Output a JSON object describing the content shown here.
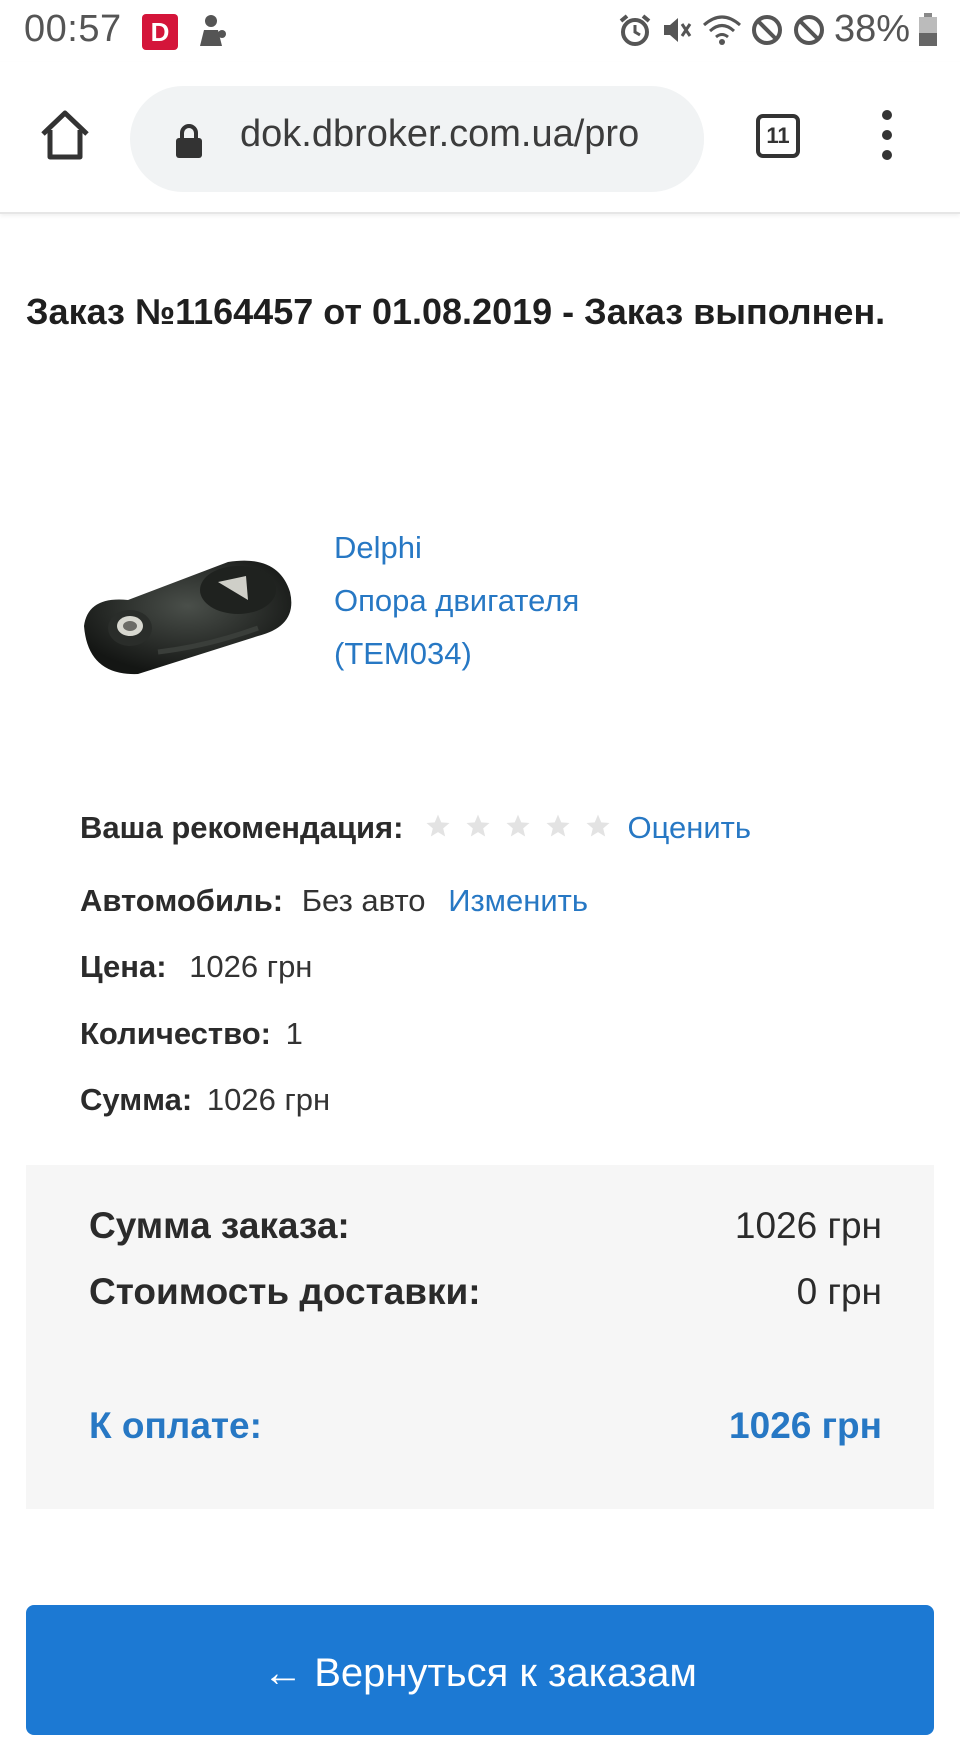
{
  "status_bar": {
    "time": "00:57",
    "app_badge_letter": "D",
    "battery_percent": "38%",
    "icons": [
      "alarm-icon",
      "vibrate-icon",
      "wifi-icon",
      "block-icon",
      "block-icon",
      "battery-icon"
    ]
  },
  "browser": {
    "url": "dok.dbroker.com.ua/pro",
    "tab_count": "11"
  },
  "order": {
    "title": "Заказ №1164457 от 01.08.2019 - Заказ выполнен."
  },
  "product": {
    "brand": "Delphi",
    "name": "Опора двигателя",
    "code": "(TEM034)"
  },
  "details": {
    "recommendation_label": "Ваша рекомендация:",
    "rating": 0,
    "rating_max": 5,
    "rate_link": "Оценить",
    "car_label": "Автомобиль:",
    "car_value": "Без авто",
    "change_link": "Изменить",
    "price_label": "Цена:",
    "price_value": "1026 грн",
    "qty_label": "Количество:",
    "qty_value": "1",
    "sum_label": "Сумма:",
    "sum_value": "1026 грн"
  },
  "summary": {
    "order_sum_label": "Сумма заказа:",
    "order_sum_value": "1026 грн",
    "delivery_label": "Стоимость доставки:",
    "delivery_value": "0 грн",
    "to_pay_label": "К оплате:",
    "to_pay_value": "1026 грн"
  },
  "back_button": "← Вернуться к заказам",
  "colors": {
    "link": "#2778c4",
    "button": "#1c79d3",
    "badge": "#d4153a"
  }
}
